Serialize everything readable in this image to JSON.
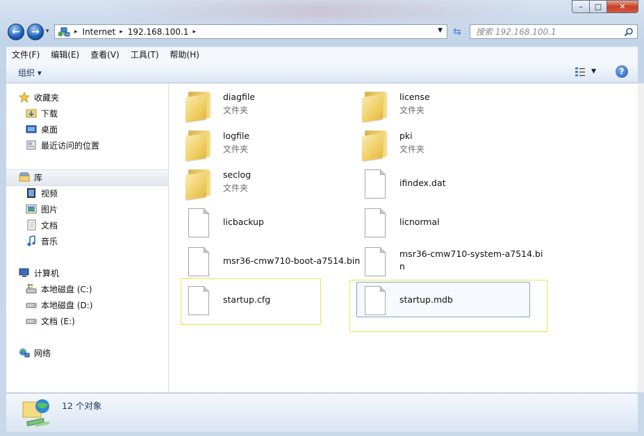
{
  "window": {
    "caption_minimize": "–",
    "caption_maximize": "□",
    "caption_close": "✕"
  },
  "address": {
    "crumbs": [
      "Internet",
      "192.168.100.1"
    ],
    "search_placeholder": "搜索 192.168.100.1"
  },
  "menu": [
    "文件(F)",
    "编辑(E)",
    "查看(V)",
    "工具(T)",
    "帮助(H)"
  ],
  "toolbar": {
    "organize": "组织 ▾"
  },
  "navpane": {
    "favorites": {
      "label": "收藏夹",
      "items": [
        "下载",
        "桌面",
        "最近访问的位置"
      ]
    },
    "libraries": {
      "label": "库",
      "items": [
        "视频",
        "图片",
        "文档",
        "音乐"
      ]
    },
    "computer": {
      "label": "计算机",
      "items": [
        "本地磁盘 (C:)",
        "本地磁盘 (D:)",
        "文档 (E:)"
      ]
    },
    "network": {
      "label": "网络"
    }
  },
  "files": [
    {
      "name": "diagfile",
      "type": "文件夹",
      "kind": "folder"
    },
    {
      "name": "license",
      "type": "文件夹",
      "kind": "folder"
    },
    {
      "name": "logfile",
      "type": "文件夹",
      "kind": "folder"
    },
    {
      "name": "pki",
      "type": "文件夹",
      "kind": "folder"
    },
    {
      "name": "seclog",
      "type": "文件夹",
      "kind": "folder"
    },
    {
      "name": "ifindex.dat",
      "type": "",
      "kind": "file"
    },
    {
      "name": "licbackup",
      "type": "",
      "kind": "file"
    },
    {
      "name": "licnormal",
      "type": "",
      "kind": "file"
    },
    {
      "name": "msr36-cmw710-boot-a7514.bin",
      "type": "",
      "kind": "file"
    },
    {
      "name_line1": "msr36-cmw710-system-a7514.bi",
      "name_line2": "n",
      "type": "",
      "kind": "file"
    },
    {
      "name": "startup.cfg",
      "type": "",
      "kind": "file"
    },
    {
      "name": "startup.mdb",
      "type": "",
      "kind": "file"
    }
  ],
  "status": {
    "count": "12 个对象"
  },
  "colors": {
    "highlight": "#f0e24a",
    "selection": "#7da2ce",
    "chrome": "#c9d9ea"
  }
}
